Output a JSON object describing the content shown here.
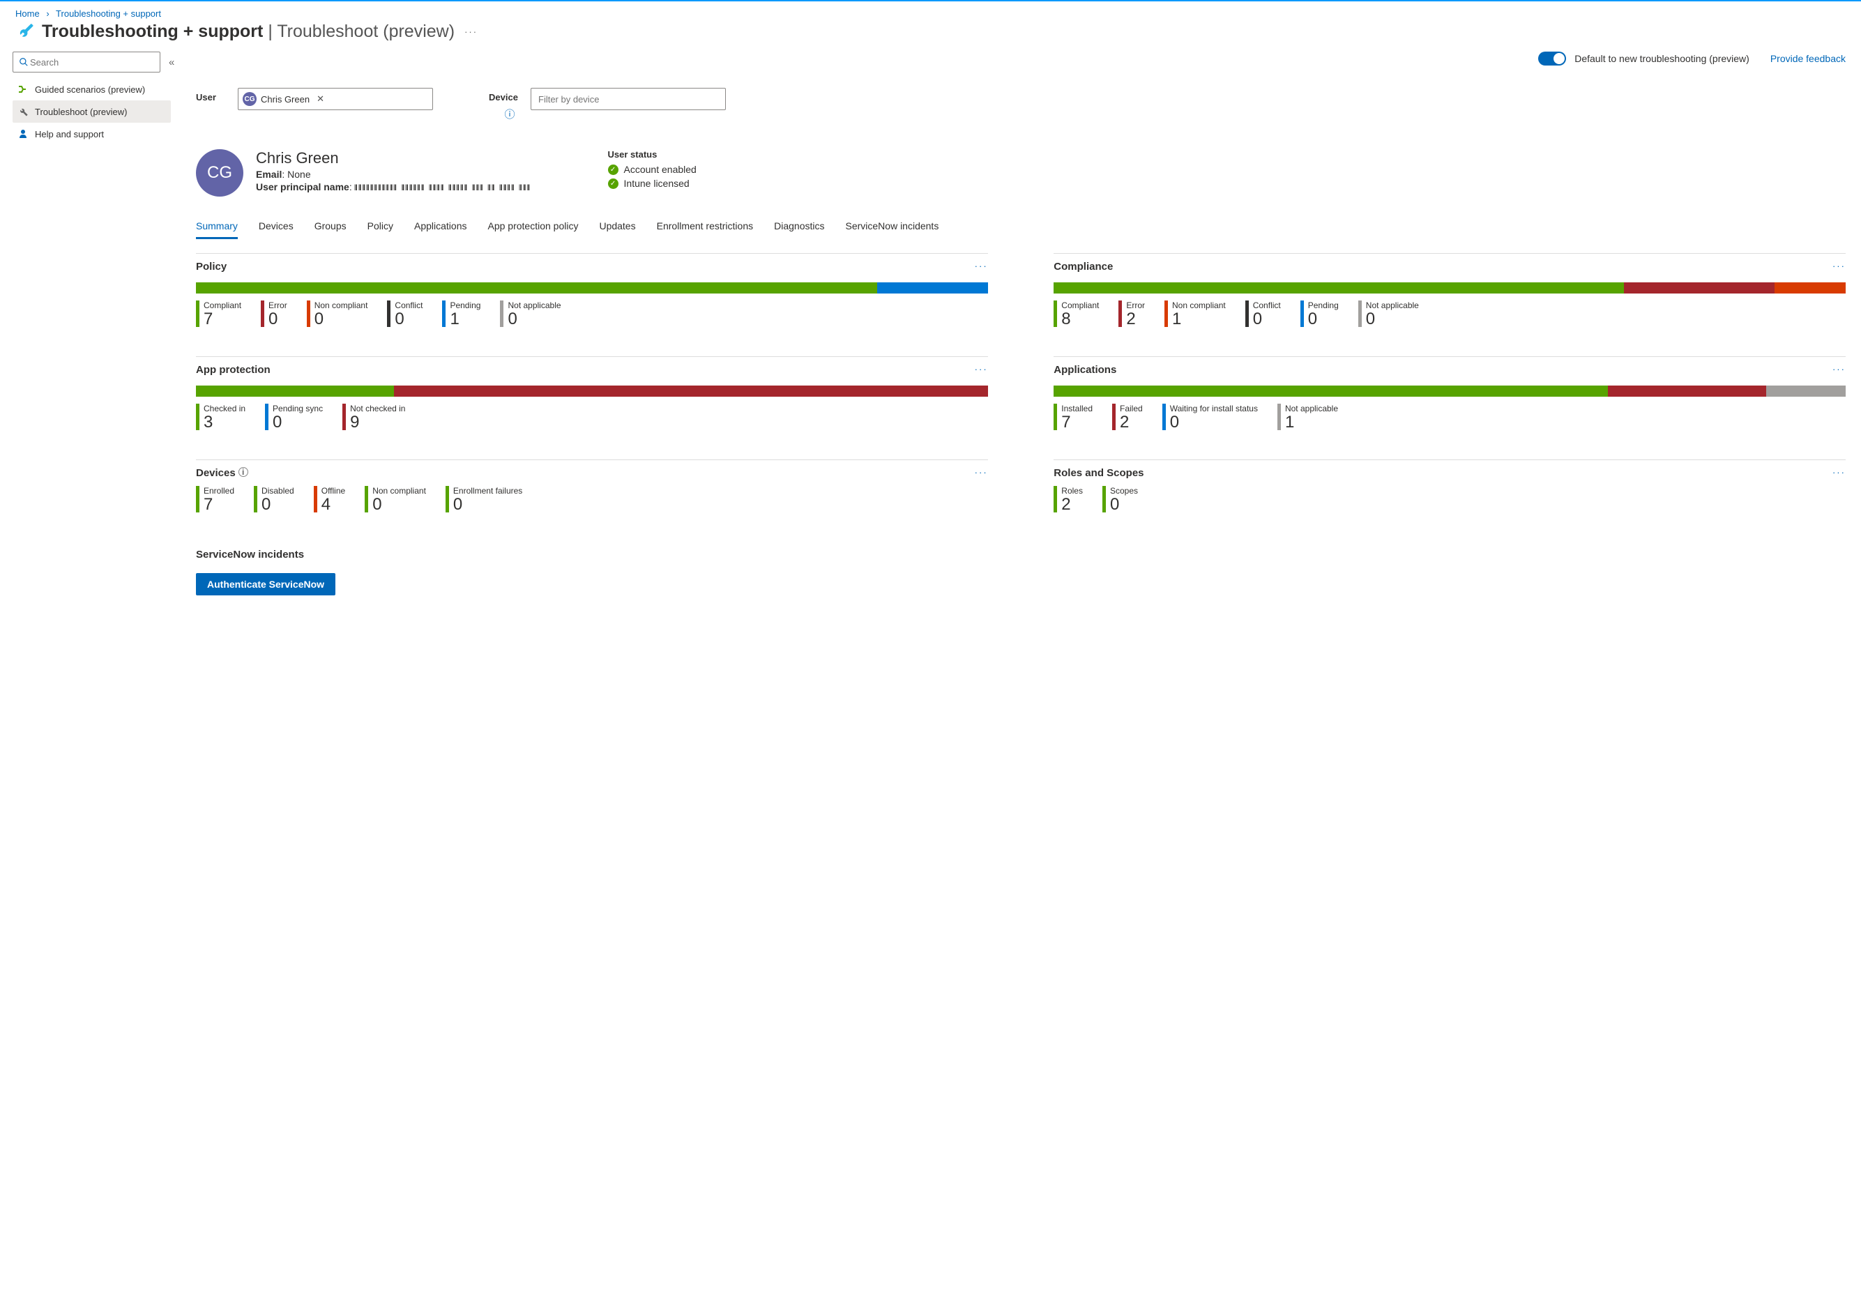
{
  "breadcrumb": {
    "home": "Home",
    "current": "Troubleshooting + support"
  },
  "title": {
    "main": "Troubleshooting + support",
    "sub": "Troubleshoot (preview)"
  },
  "search_placeholder": "Search",
  "nav": [
    {
      "label": "Guided scenarios (preview)"
    },
    {
      "label": "Troubleshoot (preview)"
    },
    {
      "label": "Help and support"
    }
  ],
  "topbar": {
    "toggle_label": "Default to new troubleshooting (preview)",
    "feedback": "Provide feedback"
  },
  "filters": {
    "user_label": "User",
    "user_chip": "Chris Green",
    "user_initials": "CG",
    "device_label": "Device",
    "device_placeholder": "Filter by device"
  },
  "profile": {
    "initials": "CG",
    "name": "Chris Green",
    "email_label": "Email",
    "email_value": "None",
    "upn_label": "User principal name",
    "upn_value": "||||||||||| |||||| |||| ||||| ||| || |||| |||"
  },
  "user_status": {
    "title": "User status",
    "rows": [
      "Account enabled",
      "Intune licensed"
    ]
  },
  "tabs": [
    "Summary",
    "Devices",
    "Groups",
    "Policy",
    "Applications",
    "App protection policy",
    "Updates",
    "Enrollment restrictions",
    "Diagnostics",
    "ServiceNow incidents"
  ],
  "colors": {
    "green": "#57a300",
    "red": "#a4262c",
    "orange": "#d83b01",
    "black": "#323130",
    "blue": "#0078d4",
    "grey": "#a19f9d"
  },
  "cards": {
    "policy": {
      "title": "Policy",
      "bar": [
        {
          "c": "green",
          "w": 86
        },
        {
          "c": "blue",
          "w": 14
        }
      ],
      "stats": [
        {
          "l": "Compliant",
          "v": "7",
          "c": "green"
        },
        {
          "l": "Error",
          "v": "0",
          "c": "red"
        },
        {
          "l": "Non compliant",
          "v": "0",
          "c": "orange"
        },
        {
          "l": "Conflict",
          "v": "0",
          "c": "black"
        },
        {
          "l": "Pending",
          "v": "1",
          "c": "blue"
        },
        {
          "l": "Not applicable",
          "v": "0",
          "c": "grey"
        }
      ]
    },
    "compliance": {
      "title": "Compliance",
      "bar": [
        {
          "c": "green",
          "w": 72
        },
        {
          "c": "red",
          "w": 19
        },
        {
          "c": "orange",
          "w": 9
        }
      ],
      "stats": [
        {
          "l": "Compliant",
          "v": "8",
          "c": "green"
        },
        {
          "l": "Error",
          "v": "2",
          "c": "red"
        },
        {
          "l": "Non compliant",
          "v": "1",
          "c": "orange"
        },
        {
          "l": "Conflict",
          "v": "0",
          "c": "black"
        },
        {
          "l": "Pending",
          "v": "0",
          "c": "blue"
        },
        {
          "l": "Not applicable",
          "v": "0",
          "c": "grey"
        }
      ]
    },
    "appprot": {
      "title": "App protection",
      "bar": [
        {
          "c": "green",
          "w": 25
        },
        {
          "c": "red",
          "w": 75
        }
      ],
      "stats": [
        {
          "l": "Checked in",
          "v": "3",
          "c": "green"
        },
        {
          "l": "Pending sync",
          "v": "0",
          "c": "blue"
        },
        {
          "l": "Not checked in",
          "v": "9",
          "c": "red"
        }
      ]
    },
    "apps": {
      "title": "Applications",
      "bar": [
        {
          "c": "green",
          "w": 70
        },
        {
          "c": "red",
          "w": 20
        },
        {
          "c": "grey",
          "w": 10
        }
      ],
      "stats": [
        {
          "l": "Installed",
          "v": "7",
          "c": "green"
        },
        {
          "l": "Failed",
          "v": "2",
          "c": "red"
        },
        {
          "l": "Waiting for install status",
          "v": "0",
          "c": "blue"
        },
        {
          "l": "Not applicable",
          "v": "1",
          "c": "grey"
        }
      ]
    },
    "devices": {
      "title": "Devices",
      "info": true,
      "stats": [
        {
          "l": "Enrolled",
          "v": "7",
          "c": "green"
        },
        {
          "l": "Disabled",
          "v": "0",
          "c": "green"
        },
        {
          "l": "Offline",
          "v": "4",
          "c": "orange"
        },
        {
          "l": "Non compliant",
          "v": "0",
          "c": "green"
        },
        {
          "l": "Enrollment failures",
          "v": "0",
          "c": "green"
        }
      ]
    },
    "roles": {
      "title": "Roles and Scopes",
      "stats": [
        {
          "l": "Roles",
          "v": "2",
          "c": "green"
        },
        {
          "l": "Scopes",
          "v": "0",
          "c": "green"
        }
      ]
    }
  },
  "servicenow": {
    "title": "ServiceNow incidents",
    "button": "Authenticate ServiceNow"
  }
}
